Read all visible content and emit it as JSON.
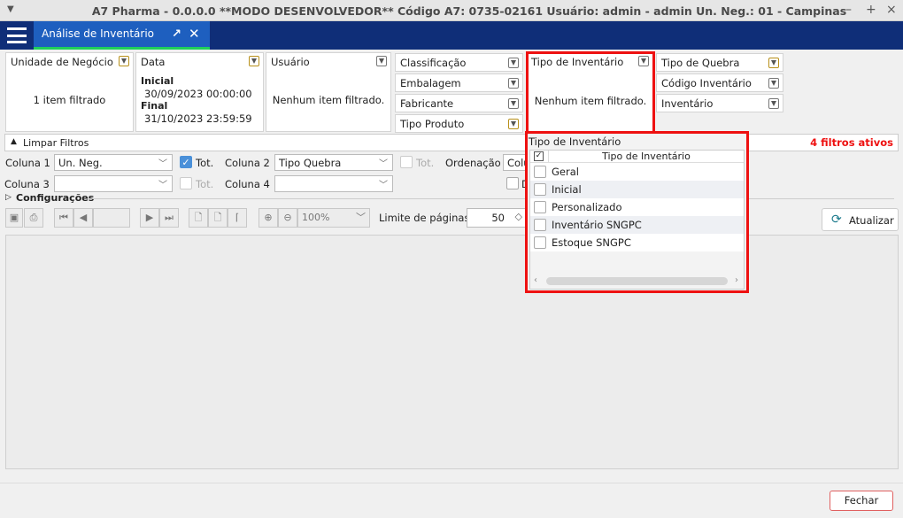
{
  "window": {
    "title": "A7 Pharma - 0.0.0.0   **MODO DESENVOLVEDOR**   Código A7: 0735-02161   Usuário: admin - admin   Un. Neg.: 01 - Campinas",
    "controls": [
      "–",
      "+",
      "×"
    ]
  },
  "tab": {
    "label": "Análise de Inventário",
    "popout": "↗",
    "close": "✕"
  },
  "filters": {
    "unidade": {
      "title": "Unidade de Negócio",
      "summary": "1 item filtrado"
    },
    "data": {
      "title": "Data",
      "inicial_label": "Inicial",
      "inicial": "30/09/2023 00:00:00",
      "final_label": "Final",
      "final": "31/10/2023 23:59:59"
    },
    "usuario": {
      "title": "Usuário",
      "summary": "Nenhum item filtrado."
    },
    "buttons1": [
      "Classificação",
      "Embalagem",
      "Fabricante",
      "Tipo Produto"
    ],
    "tipo_inventario": {
      "title": "Tipo de Inventário",
      "summary": "Nenhum item filtrado."
    },
    "buttons2": [
      "Tipo de Quebra",
      "Código Inventário",
      "Inventário"
    ]
  },
  "limpar": {
    "label": "Limpar Filtros",
    "active": "4 filtros ativos"
  },
  "options": {
    "coluna1": "Coluna 1",
    "coluna1_value": "Un. Neg.",
    "tot": "Tot.",
    "coluna2": "Coluna 2",
    "coluna2_value": "Tipo Quebra",
    "ordenacao": "Ordenação",
    "ordenacao_value": "Colu",
    "coluna3": "Coluna 3",
    "coluna3_value": "",
    "coluna4": "Coluna 4",
    "coluna4_value": "",
    "d": "D",
    "configuracoes": "Configurações"
  },
  "toolbar": {
    "zoom": "100%",
    "limite_label": "Limite de páginas:",
    "limite_value": "50",
    "atualizar": "Atualizar"
  },
  "popup": {
    "title": "Tipo de Inventário",
    "column": "Tipo de Inventário",
    "items": [
      "Geral",
      "Inicial",
      "Personalizado",
      "Inventário SNGPC",
      "Estoque SNGPC"
    ]
  },
  "footer": {
    "fechar": "Fechar"
  },
  "colors": {
    "accent_red": "#ee1111",
    "header": "#0f2e78",
    "tab": "#1e5fbf"
  }
}
